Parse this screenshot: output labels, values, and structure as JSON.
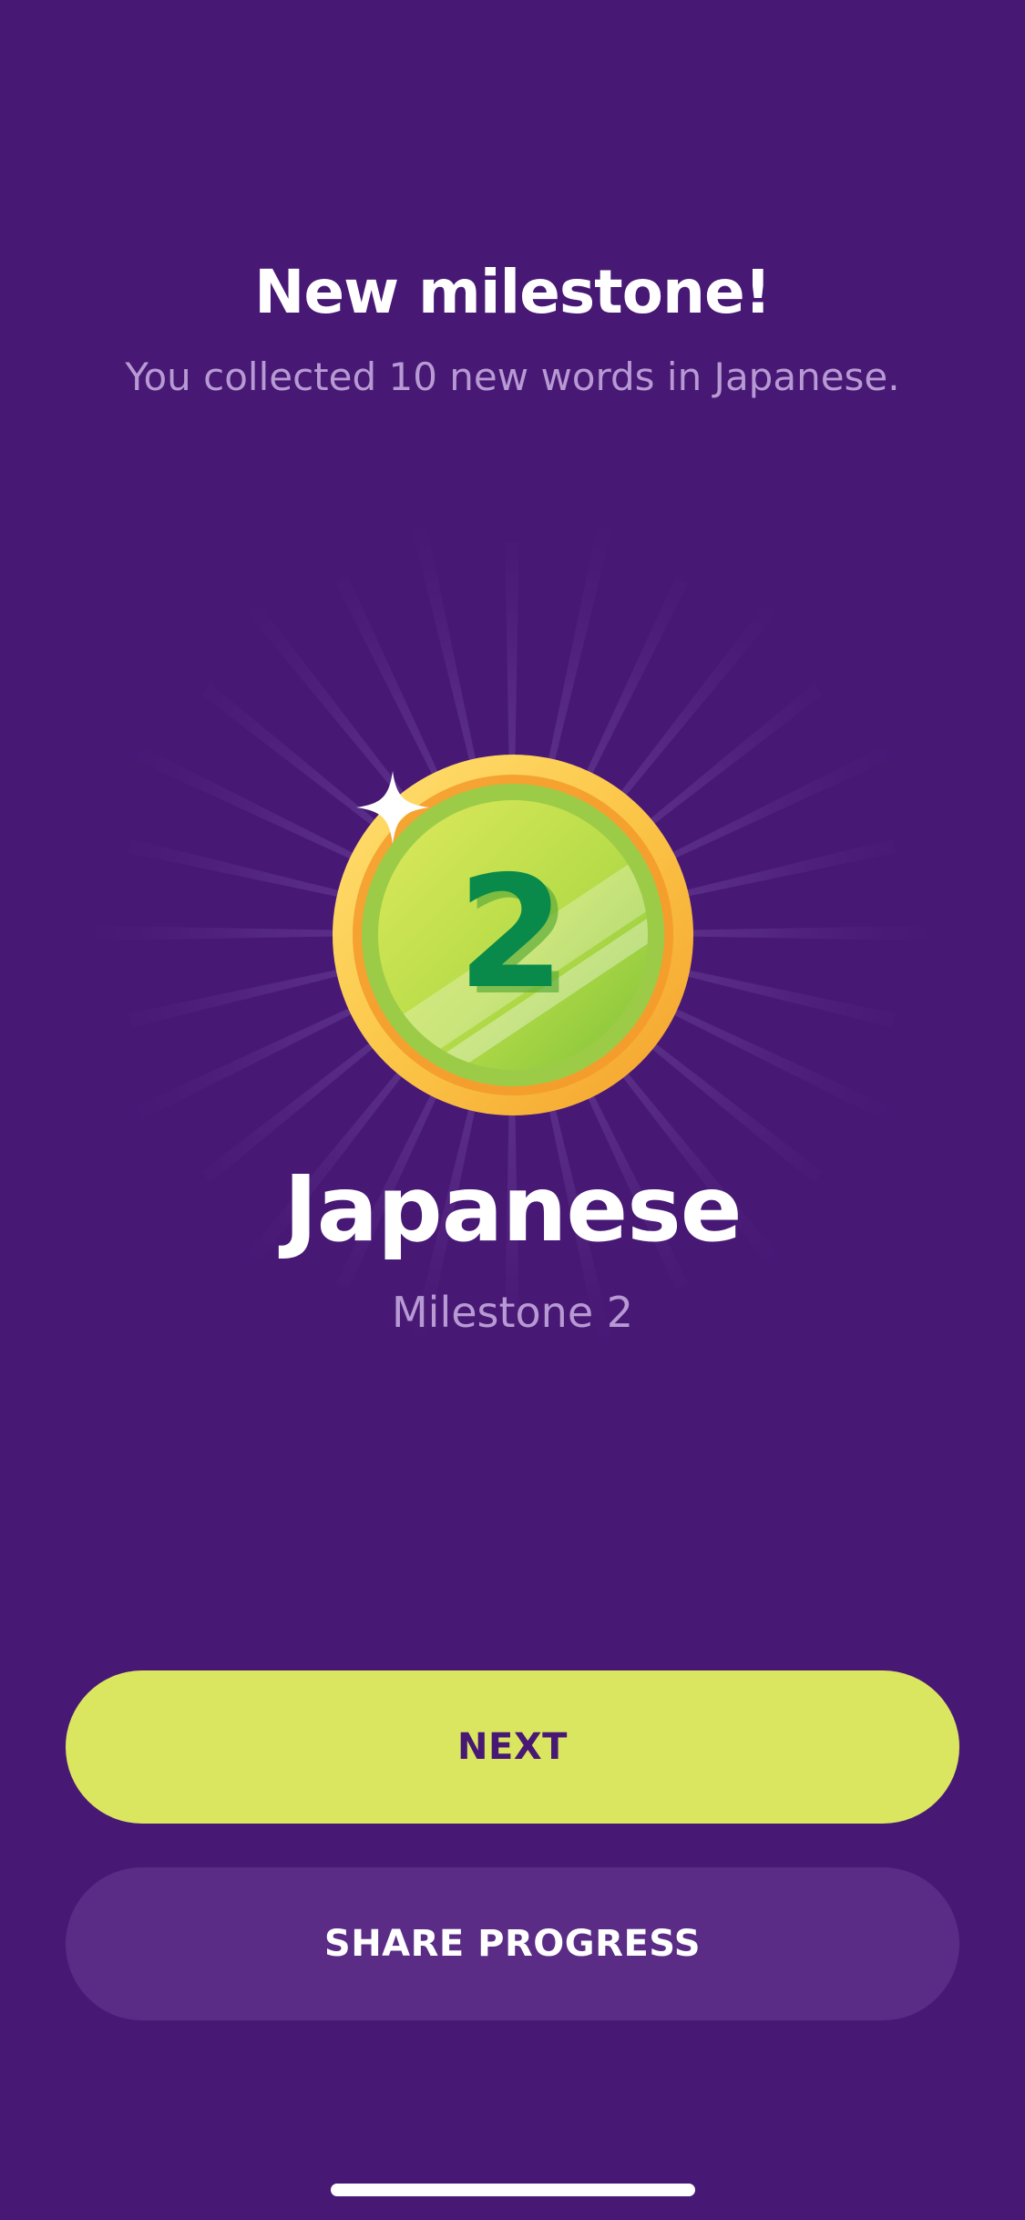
{
  "milestone": {
    "title": "New milestone!",
    "subtitle": "You collected 10 new words in Japanese.",
    "badge_number": "2",
    "language": "Japanese",
    "milestone_label": "Milestone 2"
  },
  "actions": {
    "next_label": "NEXT",
    "share_label": "SHARE PROGRESS"
  },
  "colors": {
    "background": "#481875",
    "primary_button": "#dae660",
    "secondary_button": "#5a2c86",
    "medal_green": "#0a8a4a",
    "medal_gold": "#f9c53d"
  },
  "icons": {
    "medal": "milestone-medal-icon",
    "sparkle": "sparkle-icon"
  }
}
